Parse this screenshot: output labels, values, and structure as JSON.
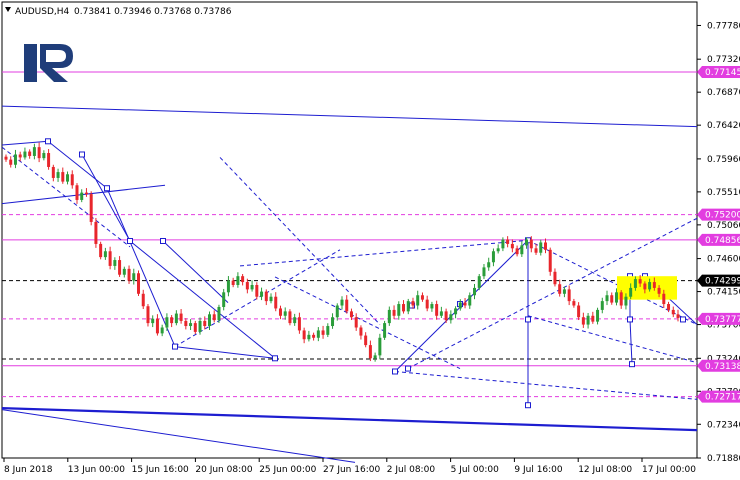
{
  "header": {
    "symbol": "AUDUSD,H4",
    "ohlc": "0.73841 0.73946 0.73768 0.73786"
  },
  "colors": {
    "bull": "#2a9d3a",
    "bear": "#e8262c",
    "trend": "#1d1dd0",
    "level": "#e23de0",
    "black_level": "#000000",
    "highlight": "#ffff00",
    "logo": "#1f3d7a"
  },
  "logo_icon": "r-monogram-logo",
  "chart_data": {
    "type": "candlestick",
    "title": "AUDUSD,H4",
    "ylim": [
      0.7188,
      0.781
    ],
    "y_ticks": [
      "0.77780",
      "0.77320",
      "0.76870",
      "0.76420",
      "0.75960",
      "0.75510",
      "0.75060",
      "0.74600",
      "0.74150",
      "0.73700",
      "0.73240",
      "0.72790",
      "0.72340",
      "0.71880"
    ],
    "x_ticks": [
      "8 Jun 2018",
      "13 Jun 00:00",
      "15 Jun 16:00",
      "20 Jun 08:00",
      "25 Jun 00:00",
      "27 Jun 16:00",
      "2 Jul 08:00",
      "5 Jul 00:00",
      "9 Jul 16:00",
      "12 Jul 08:00",
      "17 Jul 00:00"
    ],
    "price_labels": [
      {
        "text": "0.77145",
        "value": 0.77145,
        "color": "level"
      },
      {
        "text": "0.75200",
        "value": 0.752,
        "color": "level"
      },
      {
        "text": "0.74856",
        "value": 0.74856,
        "color": "level"
      },
      {
        "text": "0.74299",
        "value": 0.74299,
        "color": "black_level"
      },
      {
        "text": "0.73777",
        "value": 0.73777,
        "color": "level"
      },
      {
        "text": "0.73138",
        "value": 0.73138,
        "color": "level"
      },
      {
        "text": "0.72717",
        "value": 0.72717,
        "color": "level"
      }
    ],
    "horizontal_levels": [
      {
        "value": 0.77145,
        "style": "solid",
        "color": "level"
      },
      {
        "value": 0.752,
        "style": "dashed",
        "color": "level"
      },
      {
        "value": 0.74856,
        "style": "solid",
        "color": "level"
      },
      {
        "value": 0.74299,
        "style": "dashed",
        "color": "black_level"
      },
      {
        "value": 0.73777,
        "style": "dashed",
        "color": "level"
      },
      {
        "value": 0.7323,
        "style": "dashed",
        "color": "black_level"
      },
      {
        "value": 0.73138,
        "style": "solid",
        "color": "level"
      },
      {
        "value": 0.72717,
        "style": "dashed",
        "color": "level"
      }
    ],
    "close_series": [
      0.7595,
      0.7588,
      0.7602,
      0.7598,
      0.7606,
      0.76,
      0.7612,
      0.7597,
      0.7604,
      0.7585,
      0.757,
      0.7578,
      0.7565,
      0.7575,
      0.756,
      0.754,
      0.755,
      0.7548,
      0.751,
      0.748,
      0.7462,
      0.747,
      0.745,
      0.7458,
      0.7438,
      0.7446,
      0.743,
      0.744,
      0.7412,
      0.7395,
      0.7372,
      0.7378,
      0.7358,
      0.7366,
      0.738,
      0.7372,
      0.7385,
      0.7375,
      0.7368,
      0.7372,
      0.736,
      0.7375,
      0.7368,
      0.7384,
      0.7376,
      0.7394,
      0.7414,
      0.743,
      0.7424,
      0.7436,
      0.7428,
      0.7418,
      0.7424,
      0.7408,
      0.7415,
      0.7402,
      0.7408,
      0.7392,
      0.7382,
      0.7388,
      0.7372,
      0.738,
      0.7362,
      0.735,
      0.7356,
      0.7352,
      0.7362,
      0.7356,
      0.7368,
      0.738,
      0.7396,
      0.7404,
      0.7388,
      0.738,
      0.7366,
      0.7355,
      0.7342,
      0.7324,
      0.7328,
      0.7352,
      0.7372,
      0.739,
      0.7382,
      0.7398,
      0.7388,
      0.7402,
      0.7396,
      0.741,
      0.7404,
      0.7392,
      0.7398,
      0.7382,
      0.7388,
      0.7376,
      0.7384,
      0.7392,
      0.74,
      0.7396,
      0.741,
      0.742,
      0.7436,
      0.7448,
      0.7455,
      0.747,
      0.7474,
      0.7486,
      0.748,
      0.7474,
      0.7466,
      0.7478,
      0.7486,
      0.7474,
      0.7468,
      0.7482,
      0.7472,
      0.7442,
      0.7425,
      0.7412,
      0.7418,
      0.7402,
      0.7396,
      0.738,
      0.737,
      0.7382,
      0.7374,
      0.739,
      0.7402,
      0.741,
      0.74,
      0.7414,
      0.7396,
      0.7408,
      0.742,
      0.7432,
      0.7426,
      0.7418,
      0.7428,
      0.742,
      0.7412,
      0.7398,
      0.739,
      0.7384,
      0.7379
    ]
  }
}
